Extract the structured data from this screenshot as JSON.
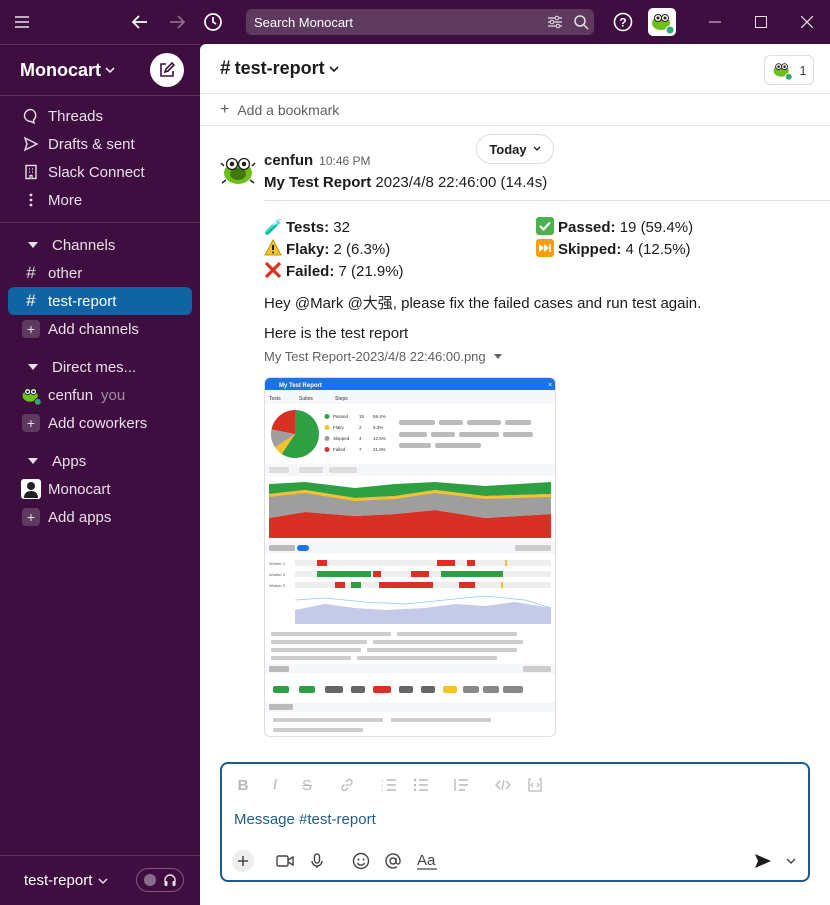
{
  "topbar": {
    "search_placeholder": "Search Monocart"
  },
  "sidebar": {
    "workspace": "Monocart",
    "nav": [
      {
        "label": "Threads"
      },
      {
        "label": "Drafts & sent"
      },
      {
        "label": "Slack Connect"
      },
      {
        "label": "More"
      }
    ],
    "channels_header": "Channels",
    "channels": [
      {
        "label": "other"
      },
      {
        "label": "test-report"
      }
    ],
    "add_channels": "Add channels",
    "dm_header": "Direct mes...",
    "dm_user": "cenfun",
    "dm_you": "you",
    "add_coworkers": "Add coworkers",
    "apps_header": "Apps",
    "app": "Monocart",
    "add_apps": "Add apps",
    "footer": "test-report"
  },
  "channel": {
    "name": "test-report",
    "member_count": "1",
    "bookmark": "Add a bookmark",
    "today": "Today"
  },
  "message": {
    "author": "cenfun",
    "time": "10:46 PM",
    "title_bold": "My Test Report",
    "title_rest": " 2023/4/8 22:46:00 (14.4s)",
    "stats": {
      "tests_label": "Tests:",
      "tests_value": " 32",
      "passed_label": "Passed:",
      "passed_value": " 19  (59.4%)",
      "flaky_label": "Flaky:",
      "flaky_value": " 2  (6.3%)",
      "skipped_label": "Skipped:",
      "skipped_value": " 4  (12.5%)",
      "failed_label": "Failed:",
      "failed_value": " 7  (21.9%)"
    },
    "text1": "Hey @Mark @大强, please fix the failed cases and run test again.",
    "text2": "Here is the test report",
    "file_name": "My Test Report-2023/4/8 22:46:00.png",
    "thumbnail_title": "My Test Report",
    "thumbnail_tabs": [
      "Tests",
      "Suites",
      "Steps"
    ],
    "pie": [
      {
        "label": "Passed",
        "value": 19,
        "pct": "59.4%",
        "color": "#2ea043"
      },
      {
        "label": "Flaky",
        "value": 2,
        "pct": "6.3%",
        "color": "#f5c12e"
      },
      {
        "label": "Skipped",
        "value": 4,
        "pct": "12.5%",
        "color": "#9e9e9e"
      },
      {
        "label": "Failed",
        "value": 7,
        "pct": "21.9%",
        "color": "#d93025"
      }
    ]
  },
  "composer": {
    "placeholder": "Message #test-report"
  },
  "colors": {
    "sidebar": "#3f0e40",
    "active": "#1164a3",
    "composer_border": "#1d5c8b"
  }
}
